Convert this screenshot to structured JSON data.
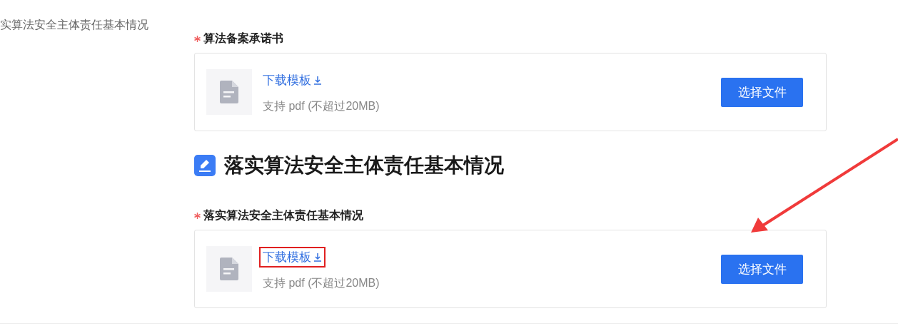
{
  "sidebar": {
    "items": [
      {
        "label": "实算法安全主体责任基本情况"
      }
    ]
  },
  "sections": [
    {
      "fields": [
        {
          "label": "算法备案承诺书",
          "required": true,
          "link": "下载模板",
          "hint": "支持 pdf (不超过20MB)",
          "button": "选择文件",
          "highlighted": false
        }
      ]
    },
    {
      "title": "落实算法安全主体责任基本情况",
      "fields": [
        {
          "label": "落实算法安全主体责任基本情况",
          "required": true,
          "link": "下载模板",
          "hint": "支持 pdf (不超过20MB)",
          "button": "选择文件",
          "highlighted": true
        }
      ]
    }
  ],
  "annotation_arrow": true
}
